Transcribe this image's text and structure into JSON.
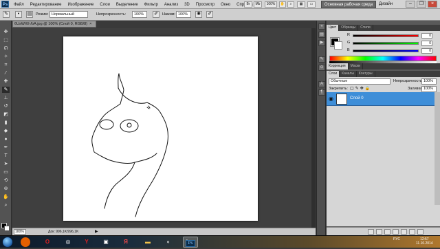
{
  "app": {
    "logo_text": "Ps"
  },
  "menu": [
    "Файл",
    "Редактирование",
    "Изображение",
    "Слои",
    "Выделение",
    "Фильтр",
    "Анализ",
    "3D",
    "Просмотр",
    "Окно",
    "Справка"
  ],
  "menubar": {
    "zoom_value": "100%",
    "workspace_button": "Основная рабочая среда",
    "design_label": "Дизайн"
  },
  "options": {
    "mode_label": "Режим:",
    "mode_value": "Нормальный",
    "opacity_label": "Непрозрачность:",
    "opacity_value": "100%",
    "pressure_label": "Нажим:",
    "pressure_value": "100%"
  },
  "document": {
    "tab_title": "6UsWXII-/bA.jpg @ 100% (Слой 0, RGB/8)",
    "tab_close": "×",
    "status_zoom": "100%",
    "status_info": "Док: 996,1K/996,1K",
    "status_arrow": "▶"
  },
  "color_panel": {
    "tabs": [
      "Цвет",
      "Образцы",
      "Стили"
    ],
    "channels": [
      {
        "label": "R",
        "value": "0"
      },
      {
        "label": "G",
        "value": "0"
      },
      {
        "label": "B",
        "value": "0"
      }
    ]
  },
  "adjust_panel": {
    "tabs": [
      "Коррекция",
      "Маски"
    ]
  },
  "layers_panel": {
    "tabs": [
      "Слои",
      "Каналы",
      "Контуры"
    ],
    "blend_mode": "Обычные",
    "opacity_label": "Непрозрачность:",
    "opacity_value": "100%",
    "lock_label": "Закрепить:",
    "fill_label": "Заливка:",
    "fill_value": "100%",
    "layers": [
      {
        "name": "Слой 0",
        "visible": true
      }
    ]
  },
  "taskbar": {
    "apps": [
      "firefox",
      "opera",
      "chrome-like",
      "yandex",
      "app",
      "yandex-browser",
      "folder",
      "obs",
      "paint",
      "photoshop"
    ],
    "tray_lang": "РУС",
    "time": "12:57",
    "date": "11.10.2014"
  },
  "colors": {
    "accent_layer": "#3e8ed8",
    "panel_bg": "#d6d6d6",
    "workspace_bg": "#3f3f3f"
  }
}
